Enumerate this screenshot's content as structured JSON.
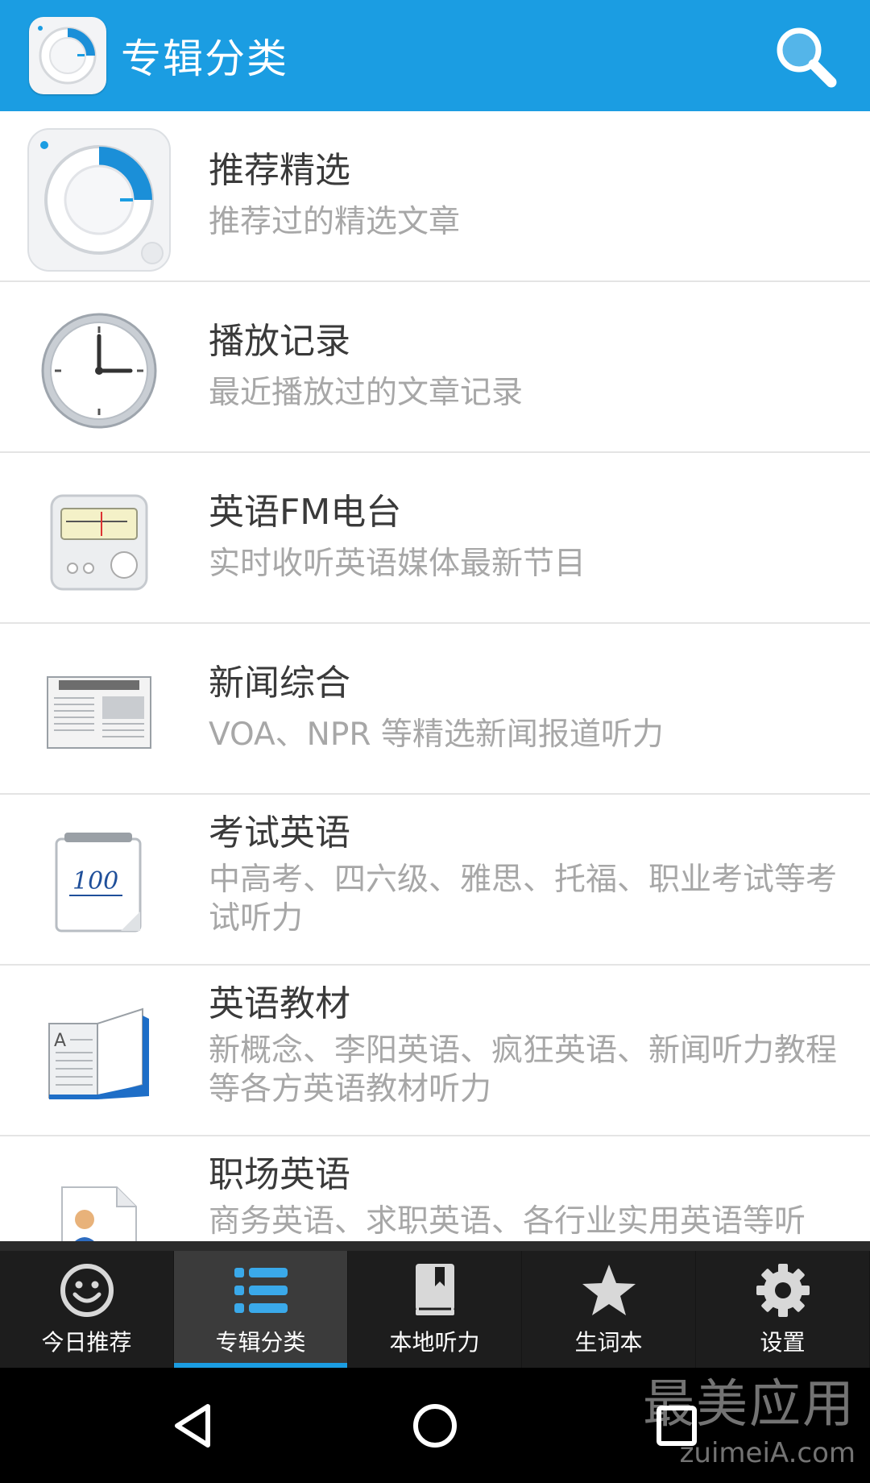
{
  "header": {
    "title": "专辑分类",
    "search_icon": "search-icon",
    "color": "#1b9de2"
  },
  "list": [
    {
      "title": "推荐精选",
      "subtitle": "推荐过的精选文章",
      "icon": "dial-icon"
    },
    {
      "title": "播放记录",
      "subtitle": "最近播放过的文章记录",
      "icon": "clock-icon"
    },
    {
      "title": "英语FM电台",
      "subtitle": "实时收听英语媒体最新节目",
      "icon": "radio-icon"
    },
    {
      "title": "新闻综合",
      "subtitle": "VOA、NPR 等精选新闻报道听力",
      "icon": "newspaper-icon"
    },
    {
      "title": "考试英语",
      "subtitle": "中高考、四六级、雅思、托福、职业考试等考试听力",
      "icon": "exam-icon"
    },
    {
      "title": "英语教材",
      "subtitle": "新概念、李阳英语、疯狂英语、新闻听力教程等各方英语教材听力",
      "icon": "book-icon"
    },
    {
      "title": "职场英语",
      "subtitle": "商务英语、求职英语、各行业实用英语等听",
      "icon": "resume-icon"
    }
  ],
  "bottom_nav": {
    "tabs": [
      {
        "label": "今日推荐",
        "icon": "smiley-icon",
        "active": false
      },
      {
        "label": "专辑分类",
        "icon": "list-icon",
        "active": true
      },
      {
        "label": "本地听力",
        "icon": "bookmark-icon",
        "active": false
      },
      {
        "label": "生词本",
        "icon": "star-icon",
        "active": false
      },
      {
        "label": "设置",
        "icon": "gear-icon",
        "active": false
      }
    ],
    "active_color": "#1b9de2"
  },
  "system_nav": {
    "watermark": "最美应用",
    "watermark_url": "zuimeiA.com"
  }
}
